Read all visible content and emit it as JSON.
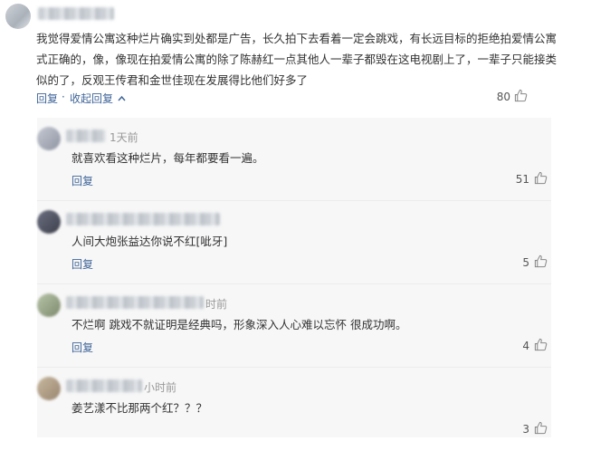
{
  "main_comment": {
    "text": "我觉得爱情公寓这种烂片确实到处都是广告，长久拍下去看着一定会跳戏，有长远目标的拒绝拍爱情公寓式正确的，像，像现在拍爱情公寓的除了陈赫红一点其他人一辈子都毁在这电视剧上了，一辈子只能接类似的了，反观王传君和金世佳现在发展得比他们好多了",
    "reply_label": "回复",
    "collapse_label": "收起回复",
    "collapse_icon": "chevron-up-icon",
    "likes": "80"
  },
  "replies": [
    {
      "time": "1天前",
      "text": "就喜欢看这种烂片，每年都要看一遍。",
      "reply_label": "回复",
      "likes": "51"
    },
    {
      "time": "",
      "text": "人间大炮张益达你说不红[呲牙]",
      "reply_label": "回复",
      "likes": "5"
    },
    {
      "time": "时前",
      "text": "不烂啊 跳戏不就证明是经典吗，形象深入人心难以忘怀 很成功啊。",
      "reply_label": "回复",
      "likes": "4"
    },
    {
      "time": "小时前",
      "text": "姜艺漾不比那两个红？？？",
      "reply_label": "回复",
      "likes": "3"
    }
  ],
  "colors": {
    "link": "#406599",
    "text": "#333333",
    "muted": "#999999",
    "reply_bg": "#f7f7f7"
  }
}
